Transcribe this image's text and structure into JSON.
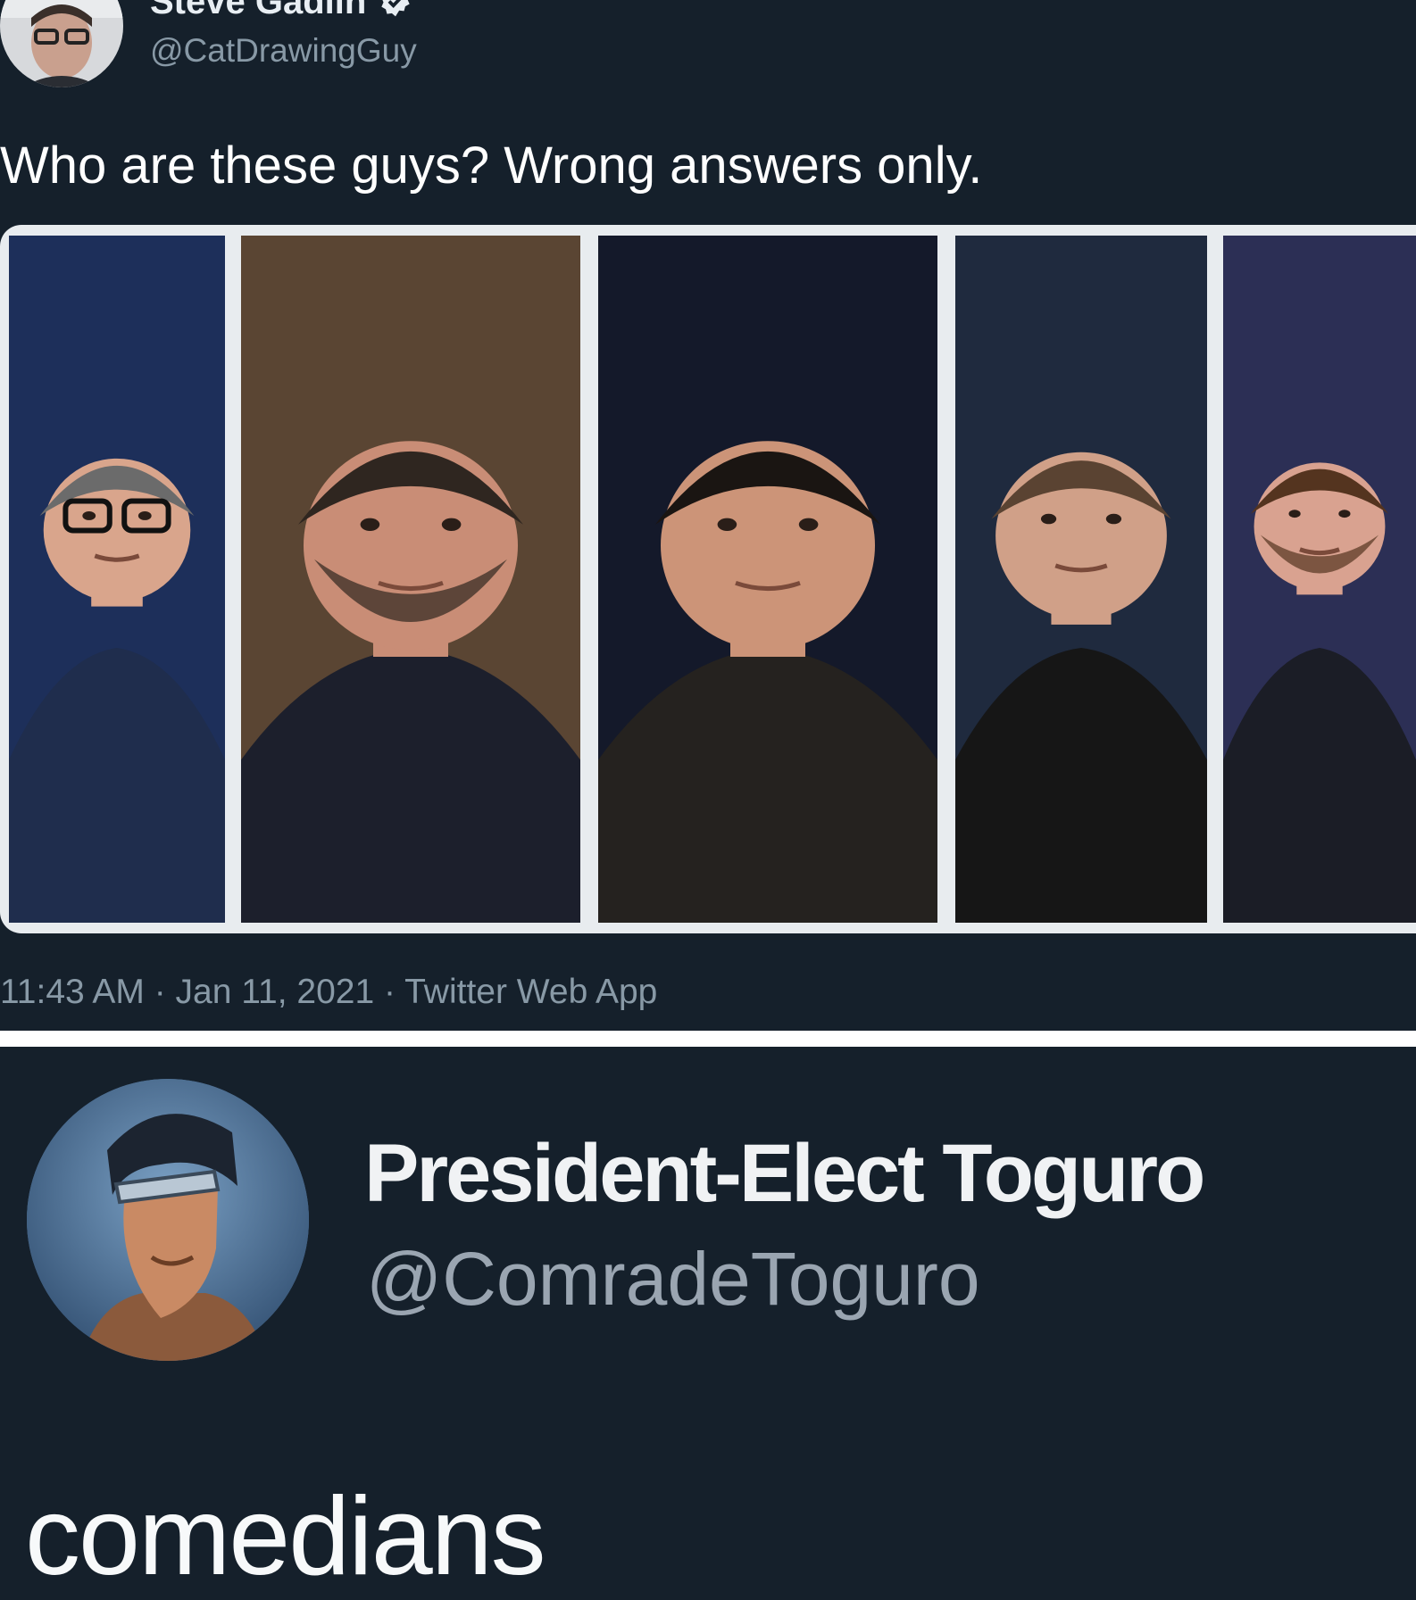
{
  "original_tweet": {
    "display_name": "Steve Gadlin",
    "handle": "@CatDrawingGuy",
    "verified": true,
    "text": "Who are these guys? Wrong answers only.",
    "meta": "11:43 AM · Jan 11, 2021 · Twitter Web App",
    "photos": [
      {
        "bg": "#1d2f5a",
        "skin": "#d9a58c",
        "hair": "#6b6b6b",
        "shirt": "#1f2d4d",
        "glasses": true,
        "beard": false
      },
      {
        "bg": "#5a4533",
        "skin": "#c98d76",
        "hair": "#2f2620",
        "shirt": "#1c1f2c",
        "glasses": false,
        "beard": true
      },
      {
        "bg": "#14192a",
        "skin": "#cc9478",
        "hair": "#1a1512",
        "shirt": "#25221f",
        "glasses": false,
        "beard": false
      },
      {
        "bg": "#1f2a3e",
        "skin": "#d0a088",
        "hair": "#5a4332",
        "shirt": "#161616",
        "glasses": false,
        "beard": false
      },
      {
        "bg": "#2c2f55",
        "skin": "#d9a290",
        "hair": "#54341f",
        "shirt": "#1b1d26",
        "glasses": false,
        "beard": true
      }
    ]
  },
  "reply_tweet": {
    "display_name": "President-Elect Toguro",
    "handle": "@ComradeToguro",
    "text": "comedians"
  },
  "colors": {
    "background": "#15202b",
    "muted_text": "#8899a6",
    "divider": "#ffffff"
  }
}
